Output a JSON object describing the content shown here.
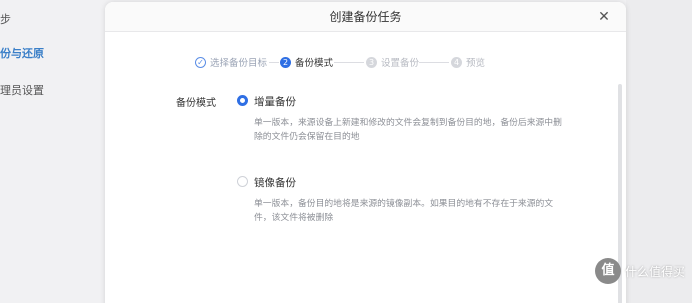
{
  "background": {
    "sidebar_items": [
      {
        "label": "步"
      },
      {
        "label": "份与还原"
      },
      {
        "label": "理员设置"
      }
    ]
  },
  "dialog": {
    "title": "创建备份任务",
    "close_icon": "close-icon",
    "steps": [
      {
        "number": "✓",
        "label": "选择备份目标",
        "state": "done"
      },
      {
        "number": "2",
        "label": "备份模式",
        "state": "active"
      },
      {
        "number": "3",
        "label": "设置备份",
        "state": "todo"
      },
      {
        "number": "4",
        "label": "预览",
        "state": "todo"
      }
    ],
    "form": {
      "field_label": "备份模式",
      "options": [
        {
          "title": "增量备份",
          "checked": true,
          "description": "单一版本，来源设备上新建和修改的文件会复制到备份目的地，备份后来源中删除的文件仍会保留在目的地"
        },
        {
          "title": "镜像备份",
          "checked": false,
          "description": "单一版本，备份目的地将是来源的镜像副本。如果目的地有不存在于来源的文件，该文件将被删除"
        }
      ]
    }
  },
  "watermark": {
    "logo": "值",
    "text": "什么值得买"
  },
  "colors": {
    "accent": "#2f6fe4",
    "muted_text": "#8c8f96",
    "sidebar_active": "#3a7fc8"
  }
}
